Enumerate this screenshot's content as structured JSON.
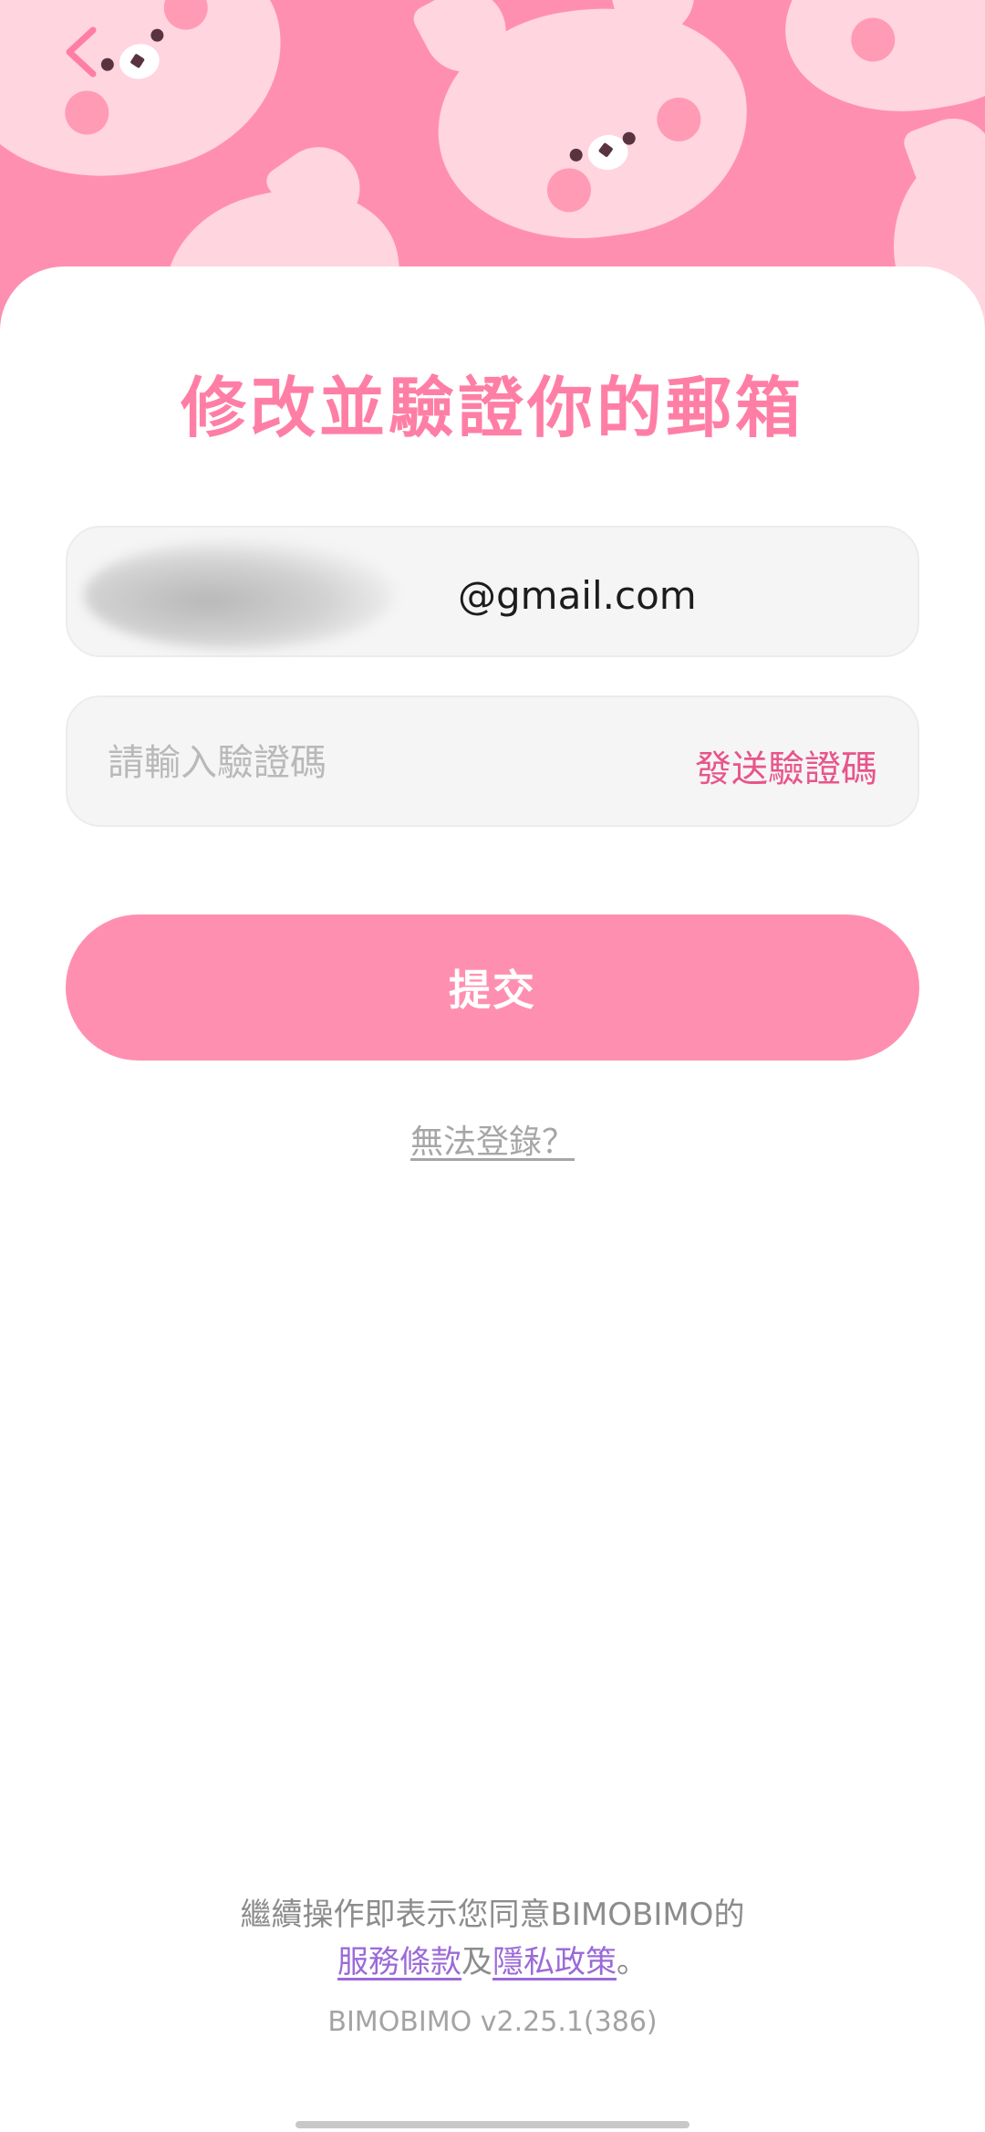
{
  "header": {
    "back_icon": "chevron-left-icon"
  },
  "title": "修改並驗證你的郵箱",
  "email": {
    "value": "@gmail.com"
  },
  "code": {
    "placeholder": "請輸入驗證碼",
    "send_label": "發送驗證碼"
  },
  "submit_label": "提交",
  "cant_login": "無法登錄？",
  "agreement": {
    "prefix": "繼續操作即表示您同意BIMOBIMO的",
    "terms": "服務條款",
    "and": "及",
    "privacy": "隱私政策",
    "suffix": "。"
  },
  "version": "BIMOBIMO v2.25.1(386)",
  "colors": {
    "brand_pink": "#ff8fb1",
    "title_pink": "#ff7ea6",
    "send_code_pink": "#e8558a",
    "link_purple": "#9b6ad8"
  }
}
